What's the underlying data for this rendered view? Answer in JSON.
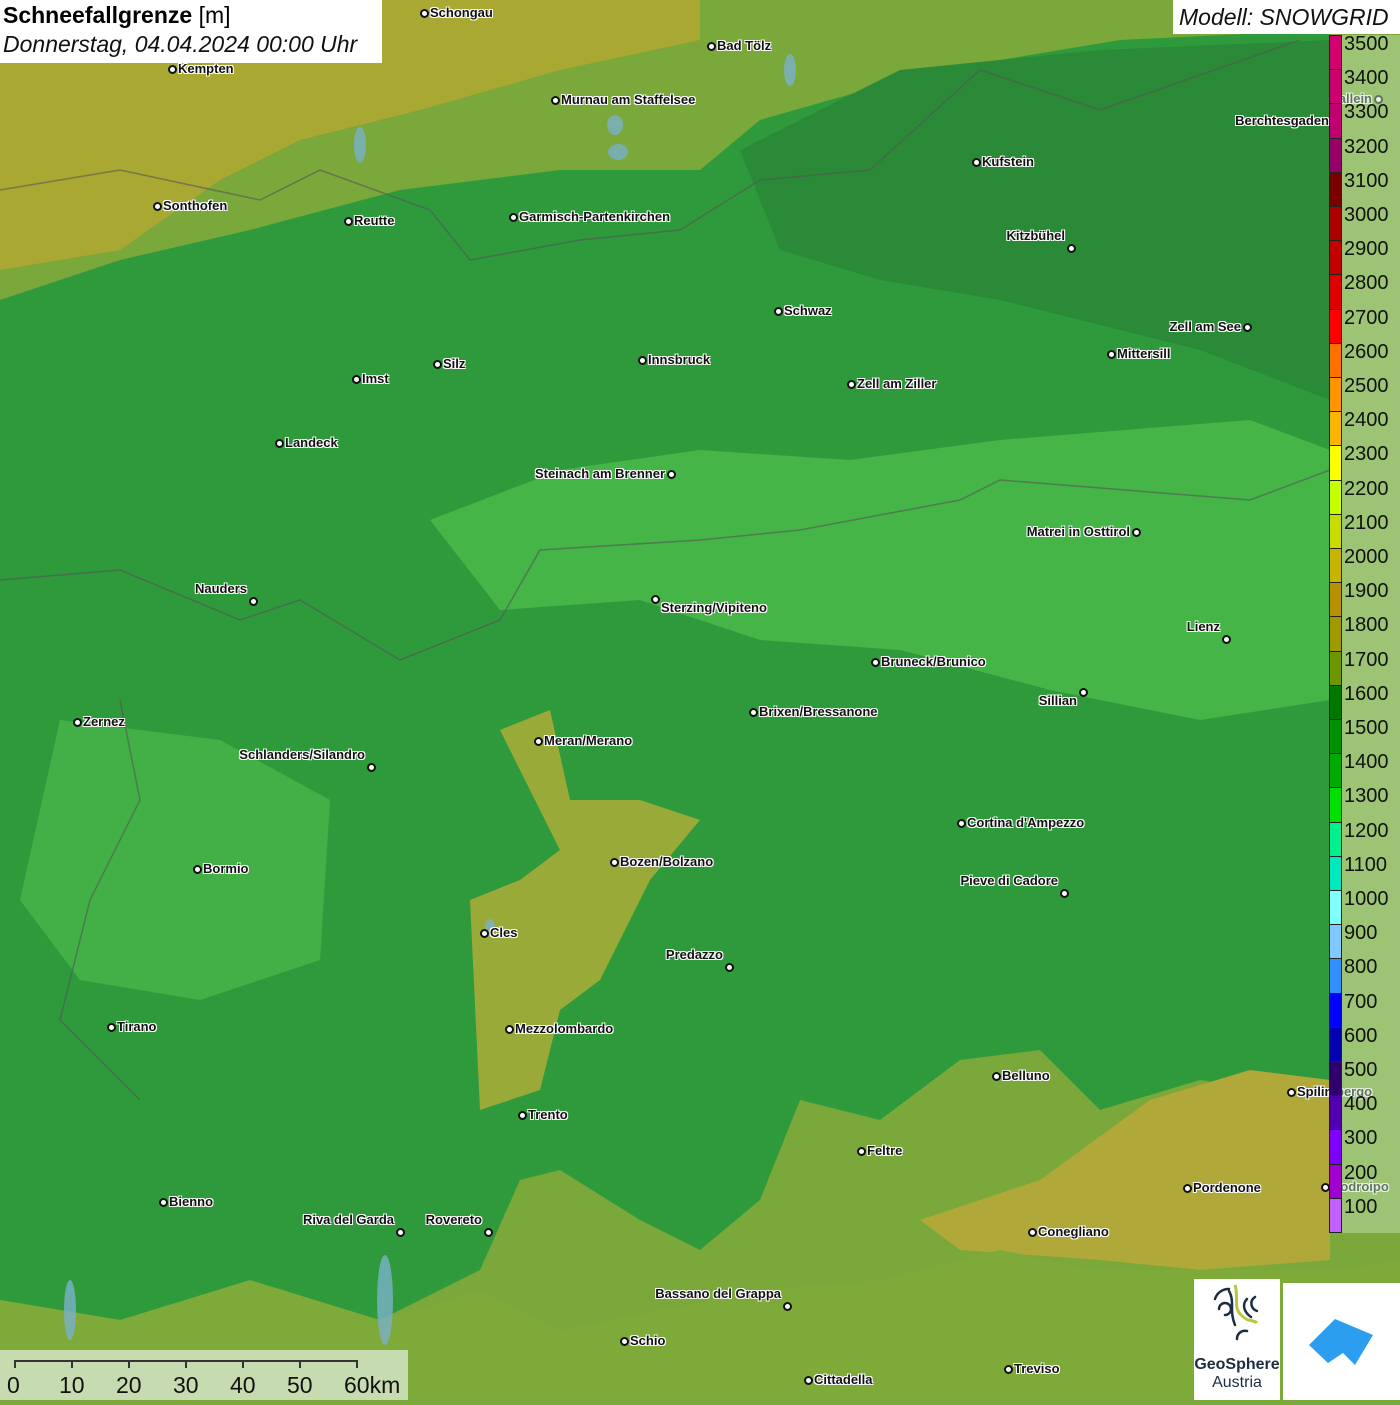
{
  "header": {
    "title": "Schneefallgrenze",
    "unit": "[m]",
    "subtitle": "Donnerstag, 04.04.2024 00:00 Uhr",
    "model": "Modell: SNOWGRID"
  },
  "legend": {
    "levels": [
      "3500",
      "3400",
      "3300",
      "3200",
      "3100",
      "3000",
      "2900",
      "2800",
      "2700",
      "2600",
      "2500",
      "2400",
      "2300",
      "2200",
      "2100",
      "2000",
      "1900",
      "1800",
      "1700",
      "1600",
      "1500",
      "1400",
      "1300",
      "1200",
      "1100",
      "1000",
      "900",
      "800",
      "700",
      "600",
      "500",
      "400",
      "300",
      "200",
      "100"
    ],
    "colors": [
      "#d4006f",
      "#cc0070",
      "#c00070",
      "#960068",
      "#7a0000",
      "#aa0000",
      "#c40000",
      "#dc0000",
      "#ff0000",
      "#ff7000",
      "#ff9400",
      "#ffb400",
      "#ffff00",
      "#c8ff00",
      "#c8dc00",
      "#c8b400",
      "#b89000",
      "#a09a00",
      "#6e9600",
      "#007800",
      "#009000",
      "#00aa00",
      "#00e000",
      "#00f090",
      "#00e8c0",
      "#80ffff",
      "#80c8ff",
      "#3090ff",
      "#0000ff",
      "#0000b0",
      "#300070",
      "#5000b0",
      "#8000ff",
      "#a000d0",
      "#c060ff"
    ]
  },
  "cities": [
    "Schongau",
    "Bad Tölz",
    "Kempten",
    "Murnau am Staffelsee",
    "Hallein",
    "Berchtesgaden",
    "Kufstein",
    "Sonthofen",
    "Reutte",
    "Garmisch-Partenkirchen",
    "Kitzbühel",
    "Schwaz",
    "Zell am See",
    "Innsbruck",
    "Mittersill",
    "Silz",
    "Imst",
    "Zell am Ziller",
    "Landeck",
    "Steinach am Brenner",
    "Matrei in Osttirol",
    "Nauders",
    "Sterzing/Vipiteno",
    "Lienz",
    "Bruneck/Brunico",
    "Sillian",
    "Brixen/Bressanone",
    "Zernez",
    "Meran/Merano",
    "Schlanders/Silandro",
    "Cortina d'Ampezzo",
    "Bozen/Bolzano",
    "Bormio",
    "Pieve di Cadore",
    "Cles",
    "Predazzo",
    "Tirano",
    "Mezzolombardo",
    "Belluno",
    "Spilimbergo",
    "Trento",
    "Feltre",
    "Pordenone",
    "Codroipo",
    "Bienno",
    "Riva del Garda",
    "Rovereto",
    "Conegliano",
    "Bassano del Grappa",
    "Schio",
    "Treviso",
    "Cittadella"
  ],
  "scale": {
    "ticks": [
      "0",
      "10",
      "20",
      "30",
      "40",
      "50",
      "60km"
    ]
  },
  "logos": {
    "geosphere_line1": "GeoSphere",
    "geosphere_line2": "Austria"
  }
}
